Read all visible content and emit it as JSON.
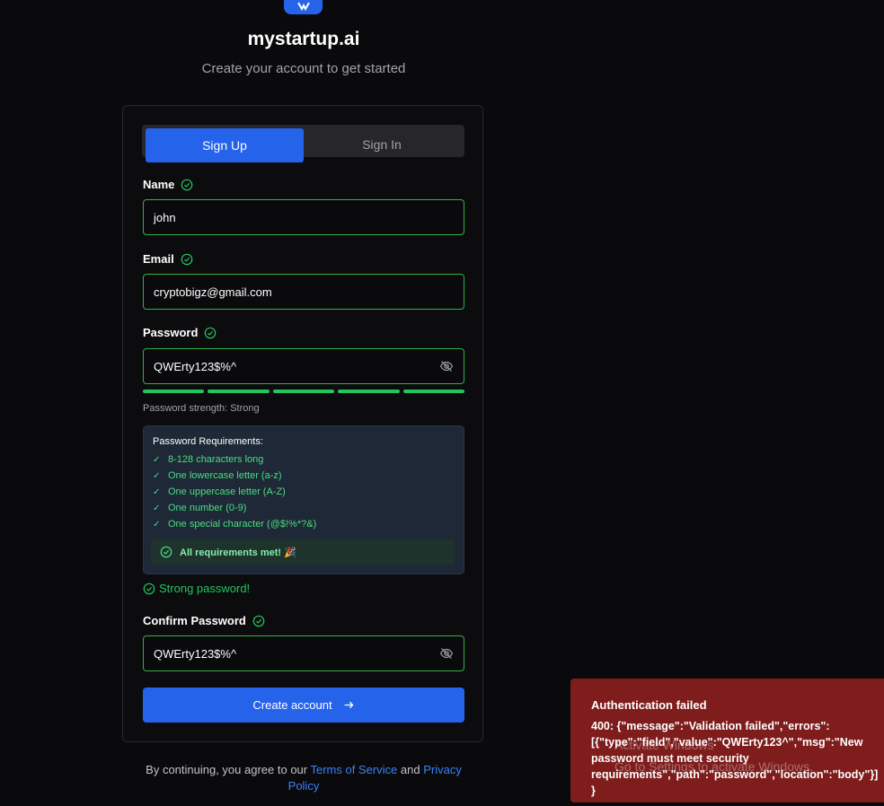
{
  "brand": {
    "name": "mystartup.ai",
    "subtitle": "Create your account to get started"
  },
  "tabs": [
    {
      "label": "Sign Up",
      "active": true
    },
    {
      "label": "Sign In",
      "active": false
    }
  ],
  "form": {
    "name_label": "Name",
    "name_value": "john",
    "email_label": "Email",
    "email_value": "cryptobigz@gmail.com",
    "password_label": "Password",
    "password_value": "QWErty123$%^",
    "strength_segments_filled": 5,
    "strength_text": "Password strength: Strong",
    "confirm_label": "Confirm Password",
    "confirm_value": "QWErty123$%^"
  },
  "requirements": {
    "title": "Password Requirements:",
    "items": [
      "8-128 characters long",
      "One lowercase letter (a-z)",
      "One uppercase letter (A-Z)",
      "One number (0-9)",
      "One special character (@$!%*?&)"
    ],
    "all_met": "All requirements met! 🎉"
  },
  "strong_msg": "Strong password!",
  "create_button": "Create account",
  "terms": {
    "prefix": "By continuing, you agree to our ",
    "tos": "Terms of Service",
    "and": " and ",
    "privacy": "Privacy Policy"
  },
  "toast": {
    "title": "Authentication failed",
    "message": "400: {\"message\":\"Validation failed\",\"errors\":[{\"type\":\"field\",\"value\":\"QWErty123^\",\"msg\":\"New password must meet security requirements\",\"path\":\"password\",\"location\":\"body\"}]}"
  },
  "watermark": {
    "line1": "Activate Windows",
    "line2": "Go to Settings to activate Windows."
  },
  "colors": {
    "accent": "#2563eb",
    "success": "#22c55e",
    "error_bg": "#7f1d1d"
  }
}
